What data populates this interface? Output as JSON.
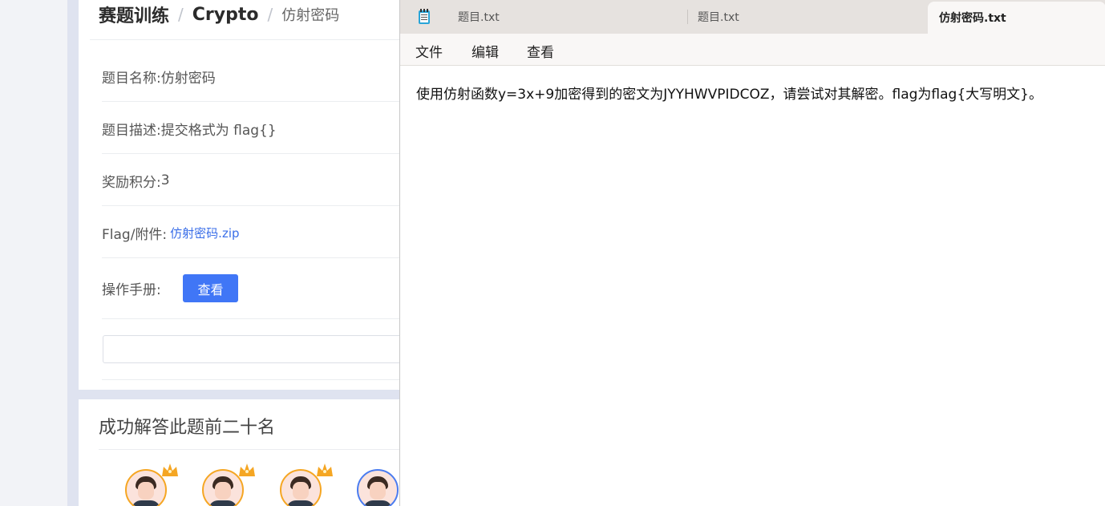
{
  "web": {
    "breadcrumb": {
      "level1": "赛题训练",
      "sep1": "/",
      "level2": "Crypto",
      "sep2": "/",
      "current": "仿射密码"
    },
    "info": {
      "name_label": "题目名称:",
      "name_value": "仿射密码",
      "desc_label": "题目描述:",
      "desc_value": "提交格式为 flag{}",
      "points_label": "奖励积分:",
      "points_value": "3",
      "attachment_label": "Flag/附件:",
      "attachment_link": "仿射密码.zip",
      "manual_label": "操作手册:",
      "view_button": "查看"
    },
    "flag_input": {
      "value": "",
      "placeholder": ""
    },
    "ranking": {
      "title": "成功解答此题前二十名"
    }
  },
  "notepad": {
    "app_icon": "notepad-icon",
    "tabs": [
      {
        "label": "题目.txt",
        "active": false
      },
      {
        "label": "题目.txt",
        "active": false
      },
      {
        "label": "仿射密码.txt",
        "active": true
      }
    ],
    "menu": {
      "file": "文件",
      "edit": "编辑",
      "view": "查看"
    },
    "content": "使用仿射函数y=3x+9加密得到的密文为JYYHWVPIDCOZ，请尝试对其解密。flag为flag{大写明文}。"
  },
  "colors": {
    "primary_button": "#4076f6",
    "link": "#3a6ee8",
    "crown": "#f5a623"
  }
}
